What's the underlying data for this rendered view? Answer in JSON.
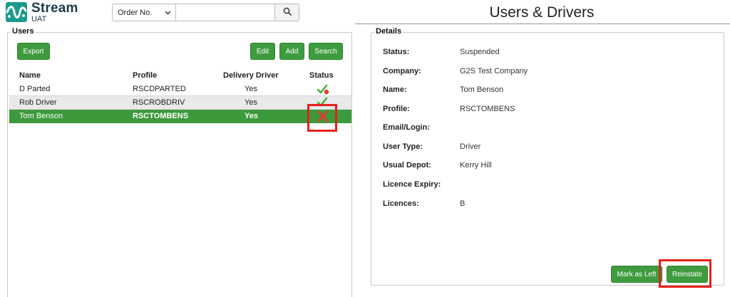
{
  "app": {
    "logo_title": "Stream",
    "logo_subtitle": "UAT",
    "page_title": "Users & Drivers",
    "brand_color": "#1a9b8a"
  },
  "search": {
    "select_value": "Order No.",
    "input_value": "",
    "button_icon": "search-icon"
  },
  "users": {
    "legend": "Users",
    "buttons": {
      "export": "Export",
      "edit": "Edit",
      "add": "Add",
      "search": "Search"
    },
    "columns": [
      "Name",
      "Profile",
      "Delivery Driver",
      "Status"
    ],
    "rows": [
      {
        "name": "D Parted",
        "profile": "RSCDPARTED",
        "delivery_driver": "Yes",
        "status_icon": "active-check-icon"
      },
      {
        "name": "Rob Driver",
        "profile": "RSCROBDRIV",
        "delivery_driver": "Yes",
        "status_icon": "active-check-icon"
      },
      {
        "name": "Tom Benson",
        "profile": "RSCTOMBENS",
        "delivery_driver": "Yes",
        "status_icon": "suspended-x-icon",
        "selected": true
      }
    ]
  },
  "details": {
    "legend": "Details",
    "fields": [
      {
        "label": "Status:",
        "value": "Suspended"
      },
      {
        "label": "Company:",
        "value": "G2S Test Company"
      },
      {
        "label": "Name:",
        "value": "Tom Benson"
      },
      {
        "label": "Profile:",
        "value": "RSCTOMBENS"
      },
      {
        "label": "Email/Login:",
        "value": ""
      },
      {
        "label": "User Type:",
        "value": "Driver"
      },
      {
        "label": "Usual Depot:",
        "value": "Kerry Hill"
      },
      {
        "label": "Licence Expiry:",
        "value": ""
      },
      {
        "label": "Licences:",
        "value": "B"
      }
    ],
    "buttons": {
      "mark_as_left": "Mark as Left",
      "reinstate": "Reinstate"
    }
  },
  "colors": {
    "accent_green": "#3e9b3e",
    "selected_row": "#3c9a3c",
    "highlight_red": "#e8201a"
  }
}
